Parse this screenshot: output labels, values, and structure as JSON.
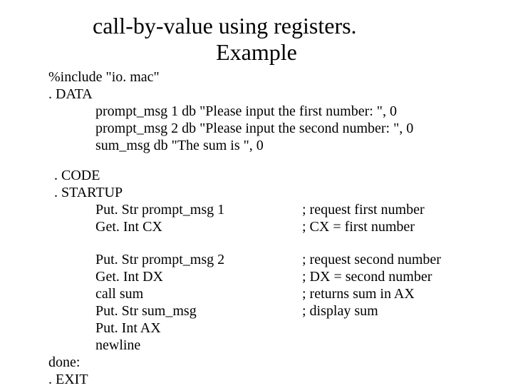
{
  "title": {
    "line1": "call-by-value using registers.",
    "line2": "Example"
  },
  "include_line": "%include \"io. mac\"",
  "data_label": ". DATA",
  "data_decl": {
    "l1": "prompt_msg 1 db \"Please input the first number: \", 0",
    "l2": "prompt_msg 2 db \"Please input the second number: \", 0",
    "l3": "sum_msg db \"The sum is \", 0"
  },
  "code_label": ". CODE",
  "startup_label": ". STARTUP",
  "block1": {
    "l1_left": "Put. Str prompt_msg 1",
    "l1_right": "; request first number",
    "l2_left": " Get. Int CX",
    "l2_right": "; CX = first number"
  },
  "block2": {
    "l1_left": "Put. Str prompt_msg 2",
    "l1_right": "; request second number",
    "l2_left": "Get. Int DX",
    "l2_right": "; DX = second number",
    "l3_left": "call sum",
    "l3_right": "; returns sum in AX",
    "l4_left": "Put. Str sum_msg",
    "l4_right": "; display sum",
    "l5_left": "Put. Int AX",
    "l6_left": "newline"
  },
  "done_label": "done:",
  "exit_label": ". EXIT"
}
